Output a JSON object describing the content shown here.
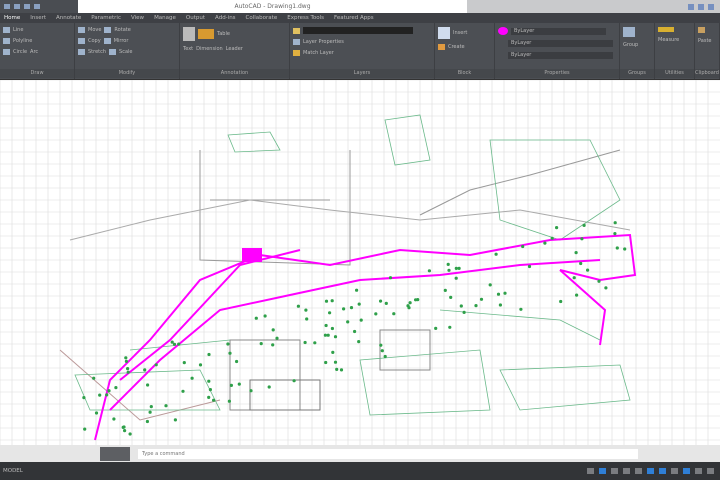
{
  "titlebar": {
    "title": "AutoCAD - Drawing1.dwg"
  },
  "tabs": [
    "Home",
    "Insert",
    "Annotate",
    "Parametric",
    "View",
    "Manage",
    "Output",
    "Add-ins",
    "Collaborate",
    "Express Tools",
    "Featured Apps"
  ],
  "panels": [
    {
      "label": "Draw",
      "items": [
        "Line",
        "Polyline",
        "Circle",
        "Arc"
      ]
    },
    {
      "label": "Modify",
      "items": [
        "Move",
        "Copy",
        "Stretch",
        "Rotate",
        "Mirror",
        "Scale"
      ]
    },
    {
      "label": "Annotation",
      "items": [
        "Text",
        "Dimension",
        "Leader",
        "Table"
      ]
    },
    {
      "label": "Layers",
      "items": [
        "Layer Properties",
        "Match Layer"
      ]
    },
    {
      "label": "Block",
      "items": [
        "Insert",
        "Create"
      ]
    },
    {
      "label": "Properties",
      "items": [
        "ByLayer",
        "ByLayer",
        "ByLayer"
      ]
    },
    {
      "label": "Groups",
      "items": [
        "Group"
      ]
    },
    {
      "label": "Utilities",
      "items": [
        "Measure"
      ]
    },
    {
      "label": "Clipboard",
      "items": [
        "Paste"
      ]
    }
  ],
  "colors": {
    "accent": "#ff00ff",
    "status_on": "#2f7fd6"
  },
  "command": {
    "placeholder": "Type a command"
  },
  "status": {
    "model": "MODEL"
  }
}
